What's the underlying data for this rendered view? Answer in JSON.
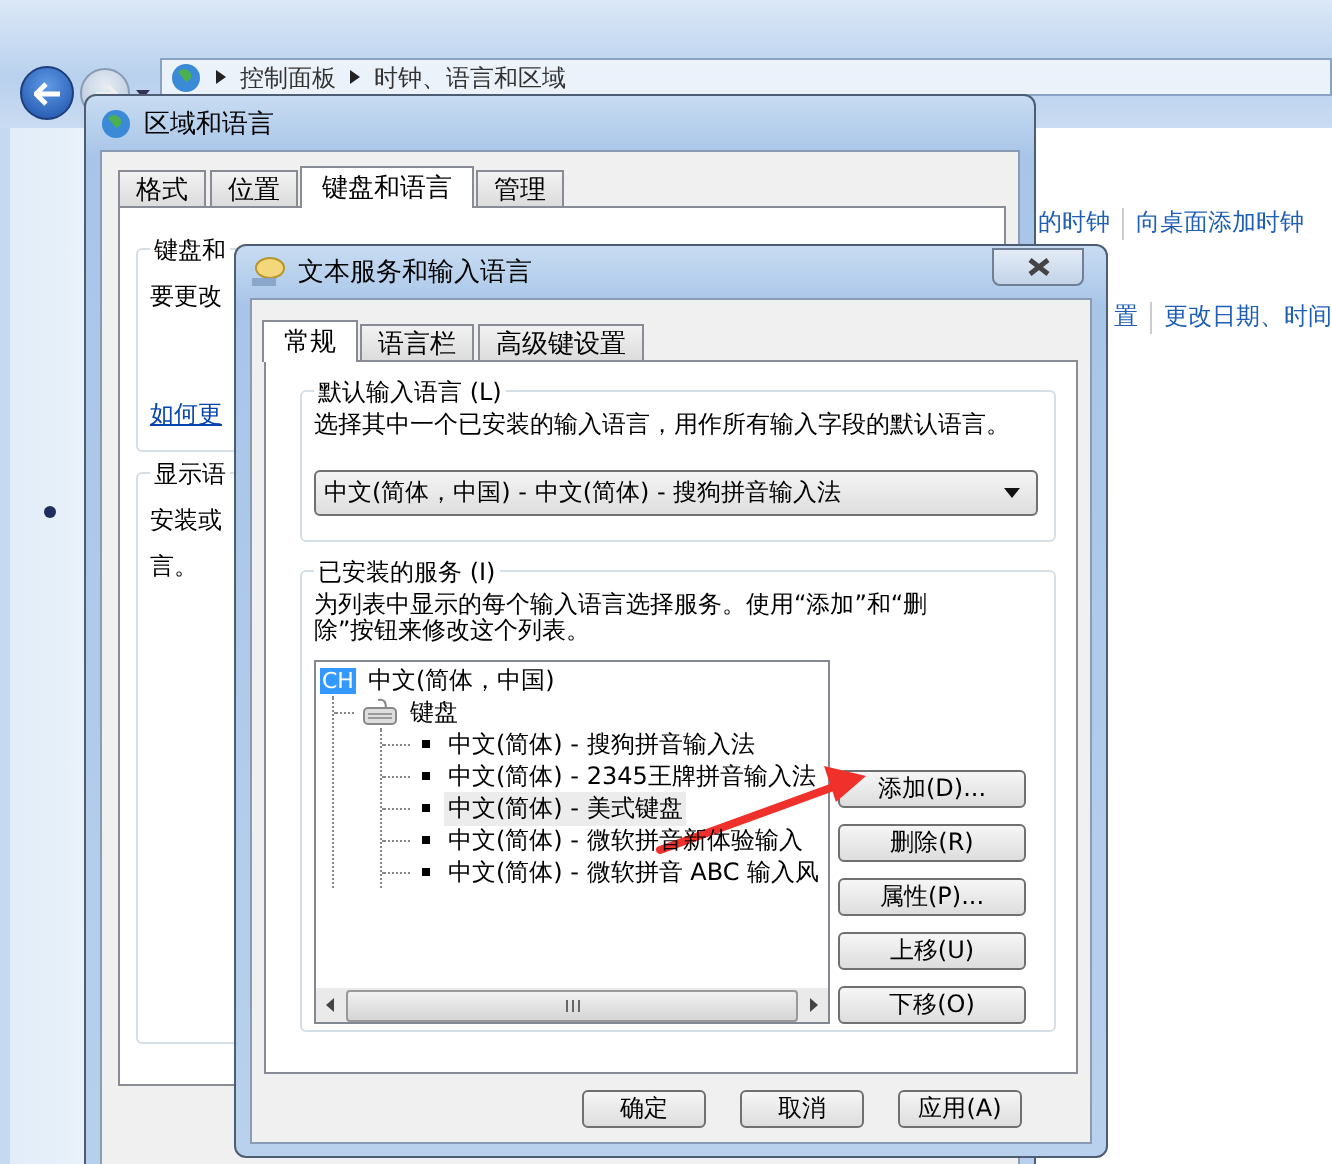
{
  "explorer": {
    "breadcrumb": [
      {
        "label": "控制面板"
      },
      {
        "label": "时钟、语言和区域"
      }
    ],
    "link_rows": [
      [
        "的时钟",
        "向桌面添加时钟"
      ],
      [
        "置",
        "更改日期、时间"
      ]
    ]
  },
  "region_window": {
    "title": "区域和语言",
    "tabs": [
      {
        "label": "格式",
        "selected": false
      },
      {
        "label": "位置",
        "selected": false
      },
      {
        "label": "键盘和语言",
        "selected": true
      },
      {
        "label": "管理",
        "selected": false
      }
    ],
    "groups": [
      {
        "title": "键盘和",
        "lines": [
          "要更改"
        ],
        "link": "如何更"
      },
      {
        "title": "显示语",
        "lines": [
          "安装或",
          "言。"
        ]
      }
    ]
  },
  "text_services": {
    "title": "文本服务和输入语言",
    "tabs": [
      {
        "label": "常规",
        "selected": true
      },
      {
        "label": "语言栏",
        "selected": false
      },
      {
        "label": "高级键设置",
        "selected": false
      }
    ],
    "default_language": {
      "title": "默认输入语言 (L)",
      "description": "选择其中一个已安装的输入语言，用作所有输入字段的默认语言。",
      "value": "中文(简体，中国) - 中文(简体) - 搜狗拼音输入法"
    },
    "installed_services": {
      "title": "已安装的服务 (I)",
      "description": "为列表中显示的每个输入语言选择服务。使用“添加”和“删除”按钮来修改这个列表。",
      "tree": [
        {
          "badge": "CH",
          "label": "中文(简体，中国)",
          "selected": false,
          "children": [
            {
              "label": "键盘",
              "selected": false,
              "children": [
                {
                  "label": "中文(简体) - 搜狗拼音输入法",
                  "selected": false
                },
                {
                  "label": "中文(简体) - 2345王牌拼音输入法",
                  "selected": false
                },
                {
                  "label": "中文(简体) - 美式键盘",
                  "selected": true
                },
                {
                  "label": "中文(简体) - 微软拼音新体验输入",
                  "selected": false
                },
                {
                  "label": "中文(简体) - 微软拼音 ABC 输入风",
                  "selected": false
                }
              ]
            }
          ]
        }
      ],
      "buttons": [
        "添加(D)...",
        "删除(R)",
        "属性(P)...",
        "上移(U)",
        "下移(O)"
      ]
    },
    "footer_buttons": [
      "确定",
      "取消",
      "应用(A)"
    ]
  }
}
